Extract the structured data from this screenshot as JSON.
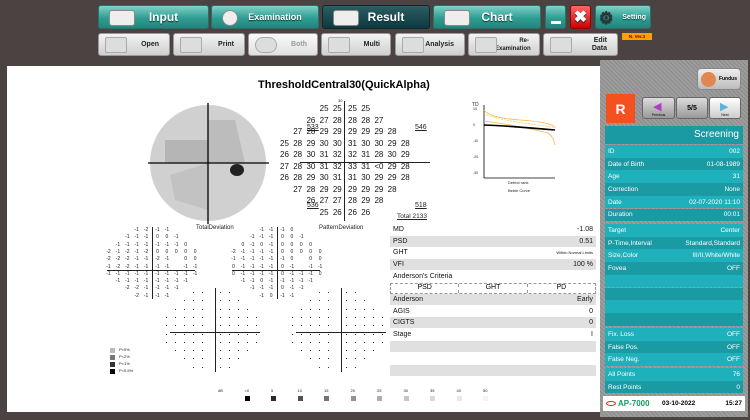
{
  "toolbar": {
    "input": "Input",
    "examination": "Examination",
    "result": "Result",
    "chart": "Chart",
    "setting": "Setting",
    "version": "N. Ver.3"
  },
  "subbar": {
    "open": "Open",
    "print": "Print",
    "both": "Both",
    "multi": "Multi",
    "analysis": "Analysis",
    "reexam": "Re-Examination",
    "edit": "Edit Data"
  },
  "report": {
    "title": "ThresholdCentral30(QuickAlpha)",
    "axis_top": "30",
    "threshold_rows": [
      [
        "25",
        "25",
        "25",
        "25"
      ],
      [
        "26",
        "27",
        "28",
        "28",
        "28",
        "27"
      ],
      [
        "27",
        "28",
        "29",
        "29",
        "29",
        "29",
        "29",
        "28"
      ],
      [
        "25",
        "28",
        "29",
        "30",
        "30",
        "31",
        "30",
        "30",
        "29",
        "28"
      ],
      [
        "26",
        "28",
        "30",
        "31",
        "32",
        "32",
        "31",
        "28",
        "30",
        "29"
      ],
      [
        "27",
        "28",
        "30",
        "31",
        "32",
        "33",
        "31",
        "<0",
        "29",
        "28"
      ],
      [
        "26",
        "28",
        "29",
        "30",
        "31",
        "31",
        "30",
        "29",
        "29",
        "28"
      ],
      [
        "27",
        "28",
        "29",
        "29",
        "29",
        "29",
        "29",
        "28"
      ],
      [
        "26",
        "27",
        "27",
        "28",
        "29",
        "28"
      ],
      [
        "25",
        "26",
        "26",
        "26"
      ]
    ],
    "quadrants": {
      "ul": "533",
      "ur": "546",
      "ll": "536",
      "lr": "518"
    },
    "total": "Total 2133",
    "total_dev_label": "TotalDeviation",
    "pattern_dev_label": "PatternDeviation",
    "total_dev": [
      [
        "-1",
        "-2",
        "-1",
        "-1"
      ],
      [
        "-1",
        "-1",
        "-1",
        "0",
        "0",
        "-1"
      ],
      [
        "-1",
        "-1",
        "-1",
        "-1",
        "-1",
        "-1",
        "-1",
        "0"
      ],
      [
        "-2",
        "-1",
        "-2",
        "-1",
        "-2",
        "0",
        "0",
        "0",
        "0",
        "0"
      ],
      [
        "-2",
        "-2",
        "-2",
        "-1",
        "-1",
        "-2",
        "-1",
        "",
        "0",
        "0"
      ],
      [
        "-1",
        "-2",
        "-2",
        "-1",
        "-1",
        "-1",
        "-1",
        "",
        "-1",
        "-1"
      ],
      [
        "-1",
        "-1",
        "-1",
        "-1",
        "-1",
        "-1",
        "-1",
        "-1",
        "-1",
        "-1"
      ],
      [
        "-1",
        "-1",
        "-1",
        "-1",
        "-1",
        "-1",
        "-1",
        "-1"
      ],
      [
        "-2",
        "-2",
        "-1",
        "-1",
        "-1",
        "-1"
      ],
      [
        "-2",
        "-1",
        "-1",
        "-1"
      ]
    ],
    "pattern_dev": [
      [
        "-1",
        "-1",
        "-1",
        "0"
      ],
      [
        "-1",
        "-1",
        "-1",
        "0",
        "0",
        "-1"
      ],
      [
        "0",
        "-1",
        "0",
        "-1",
        "0",
        "0",
        "0",
        "0"
      ],
      [
        "-2",
        "-1",
        "-1",
        "-1",
        "-1",
        "0",
        "0",
        "0",
        "0",
        "0"
      ],
      [
        "-1",
        "-1",
        "-1",
        "-1",
        "-1",
        "-1",
        "0",
        "",
        "0",
        "0"
      ],
      [
        "0",
        "-1",
        "-1",
        "-1",
        "-1",
        "0",
        "-1",
        "",
        "-1",
        "-1"
      ],
      [
        "0",
        "-1",
        "-1",
        "-1",
        "-1",
        "0",
        "-1",
        "-1",
        "-1",
        "0"
      ],
      [
        "-1",
        "-1",
        "0",
        "-1",
        "-1",
        "-1",
        "-1",
        "-1"
      ],
      [
        "-1",
        "-1",
        "-1",
        "0",
        "-1",
        "-1"
      ],
      [
        "-1",
        "0",
        "-1",
        "-1"
      ]
    ],
    "prob_legend": [
      "P<5%",
      "P<2%",
      "P<1%",
      "P<0.5%"
    ],
    "db_legend": [
      "dB",
      "<0",
      "5",
      "10",
      "15",
      "20",
      "25",
      "30",
      "35",
      "40",
      "50"
    ],
    "bebie": {
      "ylabel": "TD",
      "yticks": [
        "10",
        "0",
        "-10",
        "-20",
        "-30"
      ],
      "xlabel": "Defect rank",
      "title": "Bebie Curve"
    },
    "stats": [
      {
        "k": "MD",
        "v": "-1.08"
      },
      {
        "k": "PSD",
        "v": "0.51"
      },
      {
        "k": "GHT",
        "v": "Within Normal Limits"
      },
      {
        "k": "VFI",
        "v": "100 %"
      }
    ],
    "anderson_title": "Anderson's Criteria",
    "anderson_cols": [
      "PSD",
      "GHT",
      "PD"
    ],
    "stats2": [
      {
        "k": "Anderson",
        "v": "Early"
      },
      {
        "k": "AGIS",
        "v": "0"
      },
      {
        "k": "CIGTS",
        "v": "0"
      },
      {
        "k": "Stage",
        "v": "I"
      }
    ]
  },
  "side": {
    "fundus": "Fundus",
    "eye": "R",
    "prev": "Previous",
    "page": "5/5",
    "next": "Next",
    "mode": "Screening",
    "rows": [
      {
        "k": "ID",
        "v": "002"
      },
      {
        "k": "Date of Birth",
        "v": "01-08-1989"
      },
      {
        "k": "Age",
        "v": "31"
      },
      {
        "k": "Correction",
        "v": "None"
      },
      {
        "k": "Date",
        "v": "02-07-2020 11:10"
      },
      {
        "k": "Duration",
        "v": "00:01"
      }
    ],
    "rows2": [
      {
        "k": "Target",
        "v": "Center"
      },
      {
        "k": "P-Time,Interval",
        "v": "Standard,Standard"
      },
      {
        "k": "Size,Color",
        "v": "III/II,White/White"
      },
      {
        "k": "Fovea",
        "v": "OFF"
      }
    ],
    "rows3": [
      {
        "k": "Fix. Loss",
        "v": "OFF"
      },
      {
        "k": "False Pos.",
        "v": "OFF"
      },
      {
        "k": "False Neg.",
        "v": "OFF"
      }
    ],
    "rows4": [
      {
        "k": "All Points",
        "v": "76"
      },
      {
        "k": "Rest Points",
        "v": "0"
      }
    ]
  },
  "footer": {
    "brand": "AP-7000",
    "date": "03-10-2022",
    "time": "15:27"
  },
  "colors": {
    "accent": "#1eb1bb",
    "eye": "#f4511e"
  }
}
